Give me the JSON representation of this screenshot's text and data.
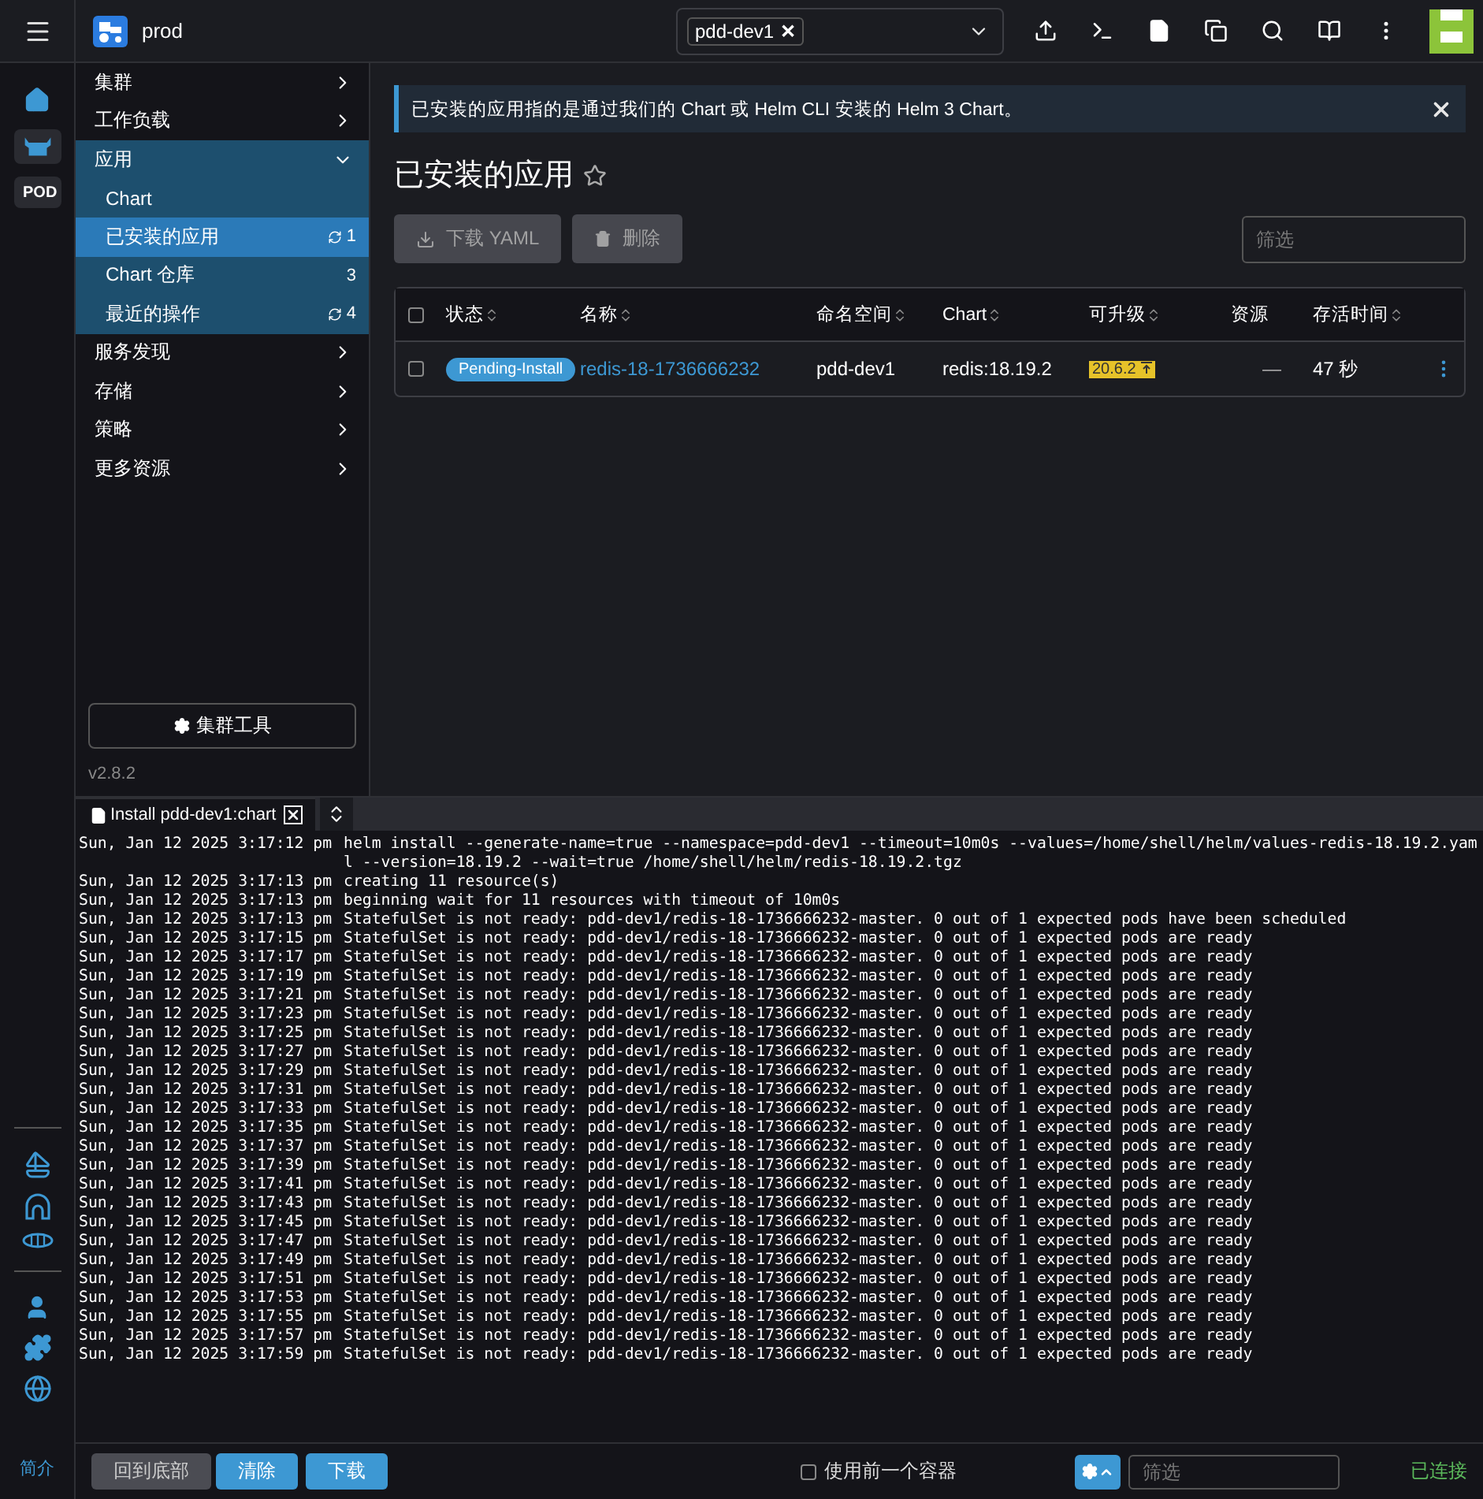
{
  "header": {
    "cluster": "prod",
    "namespace_chips": [
      {
        "label": "pdd-dev1",
        "remove": "✕"
      }
    ]
  },
  "rail": {
    "items": [
      {
        "kind": "icon",
        "selected": false
      },
      {
        "kind": "icon",
        "selected": true
      },
      {
        "kind": "text",
        "label": "POD",
        "selected": false
      }
    ],
    "bottom_link": "简介"
  },
  "nav": {
    "groups": [
      {
        "label": "集群",
        "expanded": false
      },
      {
        "label": "工作负载",
        "expanded": false
      },
      {
        "label": "应用",
        "expanded": true,
        "children": [
          {
            "label": "Chart",
            "selected": false
          },
          {
            "label": "已安装的应用",
            "selected": true,
            "count": "1",
            "sync": true
          },
          {
            "label": "Chart 仓库",
            "selected": false,
            "count": "3",
            "sync": false
          },
          {
            "label": "最近的操作",
            "selected": false,
            "count": "4",
            "sync": true
          }
        ]
      },
      {
        "label": "服务发现",
        "expanded": false
      },
      {
        "label": "存储",
        "expanded": false
      },
      {
        "label": "策略",
        "expanded": false
      },
      {
        "label": "更多资源",
        "expanded": false
      }
    ],
    "tools_button": "集群工具",
    "version": "v2.8.2"
  },
  "banner": {
    "text": "已安装的应用指的是通过我们的 Chart 或 Helm CLI 安装的 Helm 3 Chart。"
  },
  "page": {
    "title": "已安装的应用",
    "favorite": false,
    "actions": [
      {
        "label": "下载 YAML",
        "disabled": true
      },
      {
        "label": "删除",
        "disabled": true
      }
    ],
    "filter_placeholder": "筛选"
  },
  "table": {
    "select_all_checked": false,
    "columns": [
      {
        "label": "状态",
        "sortable": true
      },
      {
        "label": "名称",
        "sortable": true
      },
      {
        "label": "命名空间",
        "sortable": true
      },
      {
        "label": "Chart",
        "sortable": true
      },
      {
        "label": "可升级",
        "sortable": true
      },
      {
        "label": "资源",
        "sortable": false
      },
      {
        "label": "存活时间",
        "sortable": true
      }
    ],
    "rows": [
      {
        "checked": false,
        "status": "Pending-Install",
        "name": "redis-18-1736666232",
        "namespace": "pdd-dev1",
        "chart": "redis:18.19.2",
        "upgrade": "20.6.2",
        "resources": "—",
        "age": "47 秒"
      }
    ]
  },
  "terminal": {
    "tab": "Install pdd-dev1:chart",
    "lines": [
      {
        "time": "Sun, Jan 12 2025 3:17:12 pm",
        "message": "helm install --generate-name=true --namespace=pdd-dev1 --timeout=10m0s --values=/home/shell/helm/values-redis-18.19.2.yaml --version=18.19.2 --wait=true /home/shell/helm/redis-18.19.2.tgz"
      },
      {
        "time": "Sun, Jan 12 2025 3:17:13 pm",
        "message": "creating 11 resource(s)"
      },
      {
        "time": "Sun, Jan 12 2025 3:17:13 pm",
        "message": "beginning wait for 11 resources with timeout of 10m0s"
      },
      {
        "time": "Sun, Jan 12 2025 3:17:13 pm",
        "message": "StatefulSet is not ready: pdd-dev1/redis-18-1736666232-master. 0 out of 1 expected pods have been scheduled"
      },
      {
        "time": "Sun, Jan 12 2025 3:17:15 pm",
        "message": "StatefulSet is not ready: pdd-dev1/redis-18-1736666232-master. 0 out of 1 expected pods are ready"
      },
      {
        "time": "Sun, Jan 12 2025 3:17:17 pm",
        "message": "StatefulSet is not ready: pdd-dev1/redis-18-1736666232-master. 0 out of 1 expected pods are ready"
      },
      {
        "time": "Sun, Jan 12 2025 3:17:19 pm",
        "message": "StatefulSet is not ready: pdd-dev1/redis-18-1736666232-master. 0 out of 1 expected pods are ready"
      },
      {
        "time": "Sun, Jan 12 2025 3:17:21 pm",
        "message": "StatefulSet is not ready: pdd-dev1/redis-18-1736666232-master. 0 out of 1 expected pods are ready"
      },
      {
        "time": "Sun, Jan 12 2025 3:17:23 pm",
        "message": "StatefulSet is not ready: pdd-dev1/redis-18-1736666232-master. 0 out of 1 expected pods are ready"
      },
      {
        "time": "Sun, Jan 12 2025 3:17:25 pm",
        "message": "StatefulSet is not ready: pdd-dev1/redis-18-1736666232-master. 0 out of 1 expected pods are ready"
      },
      {
        "time": "Sun, Jan 12 2025 3:17:27 pm",
        "message": "StatefulSet is not ready: pdd-dev1/redis-18-1736666232-master. 0 out of 1 expected pods are ready"
      },
      {
        "time": "Sun, Jan 12 2025 3:17:29 pm",
        "message": "StatefulSet is not ready: pdd-dev1/redis-18-1736666232-master. 0 out of 1 expected pods are ready"
      },
      {
        "time": "Sun, Jan 12 2025 3:17:31 pm",
        "message": "StatefulSet is not ready: pdd-dev1/redis-18-1736666232-master. 0 out of 1 expected pods are ready"
      },
      {
        "time": "Sun, Jan 12 2025 3:17:33 pm",
        "message": "StatefulSet is not ready: pdd-dev1/redis-18-1736666232-master. 0 out of 1 expected pods are ready"
      },
      {
        "time": "Sun, Jan 12 2025 3:17:35 pm",
        "message": "StatefulSet is not ready: pdd-dev1/redis-18-1736666232-master. 0 out of 1 expected pods are ready"
      },
      {
        "time": "Sun, Jan 12 2025 3:17:37 pm",
        "message": "StatefulSet is not ready: pdd-dev1/redis-18-1736666232-master. 0 out of 1 expected pods are ready"
      },
      {
        "time": "Sun, Jan 12 2025 3:17:39 pm",
        "message": "StatefulSet is not ready: pdd-dev1/redis-18-1736666232-master. 0 out of 1 expected pods are ready"
      },
      {
        "time": "Sun, Jan 12 2025 3:17:41 pm",
        "message": "StatefulSet is not ready: pdd-dev1/redis-18-1736666232-master. 0 out of 1 expected pods are ready"
      },
      {
        "time": "Sun, Jan 12 2025 3:17:43 pm",
        "message": "StatefulSet is not ready: pdd-dev1/redis-18-1736666232-master. 0 out of 1 expected pods are ready"
      },
      {
        "time": "Sun, Jan 12 2025 3:17:45 pm",
        "message": "StatefulSet is not ready: pdd-dev1/redis-18-1736666232-master. 0 out of 1 expected pods are ready"
      },
      {
        "time": "Sun, Jan 12 2025 3:17:47 pm",
        "message": "StatefulSet is not ready: pdd-dev1/redis-18-1736666232-master. 0 out of 1 expected pods are ready"
      },
      {
        "time": "Sun, Jan 12 2025 3:17:49 pm",
        "message": "StatefulSet is not ready: pdd-dev1/redis-18-1736666232-master. 0 out of 1 expected pods are ready"
      },
      {
        "time": "Sun, Jan 12 2025 3:17:51 pm",
        "message": "StatefulSet is not ready: pdd-dev1/redis-18-1736666232-master. 0 out of 1 expected pods are ready"
      },
      {
        "time": "Sun, Jan 12 2025 3:17:53 pm",
        "message": "StatefulSet is not ready: pdd-dev1/redis-18-1736666232-master. 0 out of 1 expected pods are ready"
      },
      {
        "time": "Sun, Jan 12 2025 3:17:55 pm",
        "message": "StatefulSet is not ready: pdd-dev1/redis-18-1736666232-master. 0 out of 1 expected pods are ready"
      },
      {
        "time": "Sun, Jan 12 2025 3:17:57 pm",
        "message": "StatefulSet is not ready: pdd-dev1/redis-18-1736666232-master. 0 out of 1 expected pods are ready"
      },
      {
        "time": "Sun, Jan 12 2025 3:17:59 pm",
        "message": "StatefulSet is not ready: pdd-dev1/redis-18-1736666232-master. 0 out of 1 expected pods are ready"
      }
    ]
  },
  "footer": {
    "buttons": [
      {
        "label": "回到底部",
        "kind": "secondary"
      },
      {
        "label": "清除",
        "kind": "primary"
      },
      {
        "label": "下载",
        "kind": "primary"
      }
    ],
    "previous_container": {
      "label": "使用前一个容器",
      "checked": false
    },
    "filter_placeholder": "筛选",
    "status": "已连接"
  }
}
